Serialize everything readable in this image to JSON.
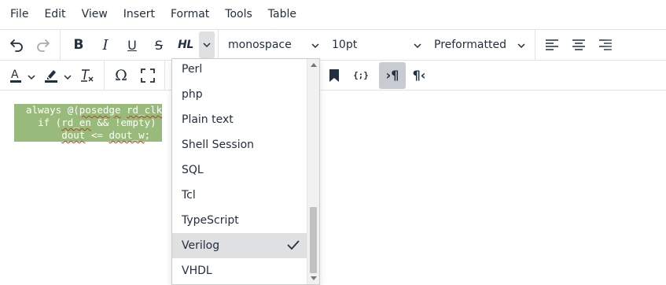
{
  "menubar": {
    "items": [
      "File",
      "Edit",
      "View",
      "Insert",
      "Format",
      "Tools",
      "Table"
    ]
  },
  "toolbar": {
    "font_family": "monospace",
    "font_size": "10pt",
    "block_format": "Preformatted",
    "highlight_label": "HL",
    "codesample_label": "{;}"
  },
  "editor": {
    "code_lines": [
      "  always @(posedge rd_clk",
      "    if (rd_en && !empty)",
      "        dout <= dout_w;"
    ]
  },
  "dropdown": {
    "items": [
      "Perl",
      "php",
      "Plain text",
      "Shell Session",
      "SQL",
      "Tcl",
      "TypeScript",
      "Verilog",
      "VHDL"
    ],
    "selected": "Verilog"
  },
  "colors": {
    "text": "#222f3e",
    "code_background": "#98bb7c",
    "selected_item_background": "#dee0e2",
    "spellcheck_underline": "#d93025"
  }
}
